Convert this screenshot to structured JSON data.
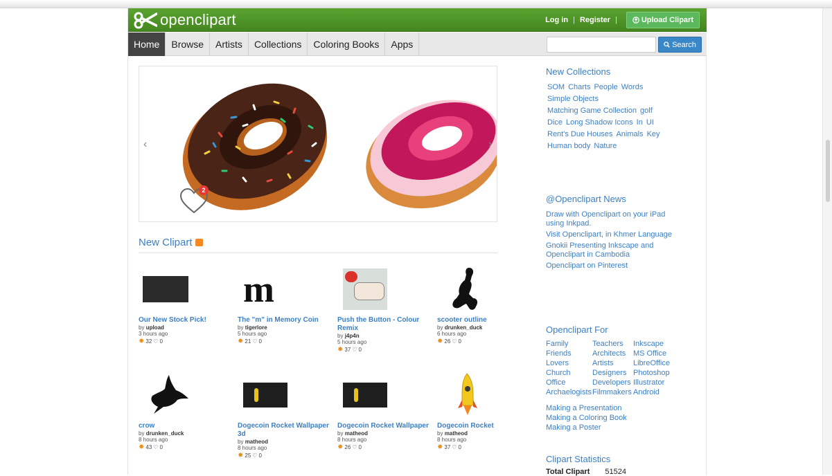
{
  "header": {
    "logo_text": "openclipart",
    "login": "Log in",
    "register": "Register",
    "upload": "Upload Clipart",
    "brand_color": "#4f9a28"
  },
  "nav": {
    "tabs": [
      "Home",
      "Browse",
      "Artists",
      "Collections",
      "Coloring Books",
      "Apps"
    ],
    "search_placeholder": "",
    "search_button": "Search"
  },
  "carousel": {
    "like_count": "2"
  },
  "new_clipart": {
    "title": "New Clipart",
    "items": [
      {
        "title": "Our New Stock Pick!",
        "by": "by",
        "author": "upload",
        "time": "3 hours ago",
        "score": "32",
        "likes": "0"
      },
      {
        "title": "The \"m\" in Memory Coin",
        "by": "by",
        "author": "tigerlore",
        "time": "5 hours ago",
        "score": "21",
        "likes": "0"
      },
      {
        "title": "Push the Button - Colour Remix",
        "by": "by",
        "author": "j4p4n",
        "time": "5 hours ago",
        "score": "37",
        "likes": "0"
      },
      {
        "title": "scooter outline",
        "by": "by",
        "author": "drunken_duck",
        "time": "6 hours ago",
        "score": "26",
        "likes": "0"
      },
      {
        "title": "crow",
        "by": "by",
        "author": "drunken_duck",
        "time": "8 hours ago",
        "score": "43",
        "likes": "0"
      },
      {
        "title": "Dogecoin Rocket Wallpaper 3d",
        "by": "by",
        "author": "matheod",
        "time": "8 hours ago",
        "score": "25",
        "likes": "0"
      },
      {
        "title": "Dogecoin Rocket Wallpaper",
        "by": "by",
        "author": "matheod",
        "time": "8 hours ago",
        "score": "26",
        "likes": "0"
      },
      {
        "title": "Dogecoin Rocket",
        "by": "by",
        "author": "matheod",
        "time": "8 hours ago",
        "score": "37",
        "likes": "0"
      }
    ]
  },
  "sidebar": {
    "collections_title": "New Collections",
    "collections": [
      [
        "SOM",
        "Charts",
        "People",
        "Words"
      ],
      [
        "Simple Objects"
      ],
      [
        "Matching Game Collection",
        "golf"
      ],
      [
        "Dice",
        "Long Shadow Icons",
        "In",
        "UI"
      ],
      [
        "Rent's Due Houses",
        "Animals",
        "Key"
      ],
      [
        "Human body",
        "Nature"
      ]
    ],
    "news_title": "@Openclipart News",
    "news": [
      "Draw with Openclipart on your iPad using Inkpad.",
      "Visit Openclipart, in Khmer Language",
      "Gnokii Presenting Inkscape and Openclipart in Cambodia",
      "Openclipart on Pinterest"
    ],
    "for_title": "Openclipart For",
    "for_items": [
      "Family",
      "Teachers",
      "Inkscape",
      "Friends",
      "Architects",
      "MS Office",
      "Lovers",
      "Artists",
      "LibreOffice",
      "Church",
      "Designers",
      "Photoshop",
      "Office",
      "Developers",
      "Illustrator",
      "Archaelogists",
      "Filmmakers",
      "Android"
    ],
    "makes": [
      "Making a Presentation",
      "Making a Coloring Book",
      "Making a Poster"
    ],
    "stats_title": "Clipart Statistics",
    "stats_label": "Total Clipart",
    "stats_value": "51524"
  }
}
